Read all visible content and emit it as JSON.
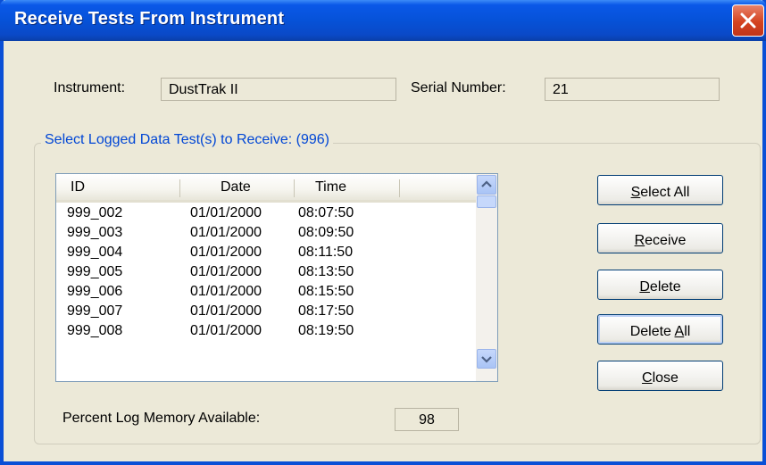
{
  "window": {
    "title": "Receive Tests From Instrument"
  },
  "instrument": {
    "label": "Instrument:",
    "value": "DustTrak II"
  },
  "serial": {
    "label": "Serial Number:",
    "value": "21"
  },
  "group": {
    "title": "Select Logged Data Test(s) to Receive: (996)"
  },
  "list": {
    "columns": [
      "ID",
      "Date",
      "Time"
    ],
    "rows": [
      [
        "999_002",
        "01/01/2000",
        "08:07:50"
      ],
      [
        "999_003",
        "01/01/2000",
        "08:09:50"
      ],
      [
        "999_004",
        "01/01/2000",
        "08:11:50"
      ],
      [
        "999_005",
        "01/01/2000",
        "08:13:50"
      ],
      [
        "999_006",
        "01/01/2000",
        "08:15:50"
      ],
      [
        "999_007",
        "01/01/2000",
        "08:17:50"
      ],
      [
        "999_008",
        "01/01/2000",
        "08:19:50"
      ]
    ]
  },
  "buttons": {
    "select_all": {
      "mnemonic": "S",
      "rest": "elect All"
    },
    "receive": {
      "mnemonic": "R",
      "rest": "eceive"
    },
    "delete": {
      "mnemonic": "D",
      "rest": "elete"
    },
    "delete_all": {
      "pre": "Delete ",
      "mnemonic": "A",
      "rest": "ll"
    },
    "close": {
      "mnemonic": "C",
      "rest": "lose"
    }
  },
  "memory": {
    "label": "Percent Log Memory Available:",
    "value": "98"
  },
  "colors": {
    "title_bar": "#0652d8",
    "group_title": "#0046d5",
    "window_bg": "#ece9d8",
    "close_button": "#d4431f"
  },
  "icons": {
    "close": "close-icon",
    "scroll_up": "chevron-up-icon",
    "scroll_down": "chevron-down-icon"
  }
}
